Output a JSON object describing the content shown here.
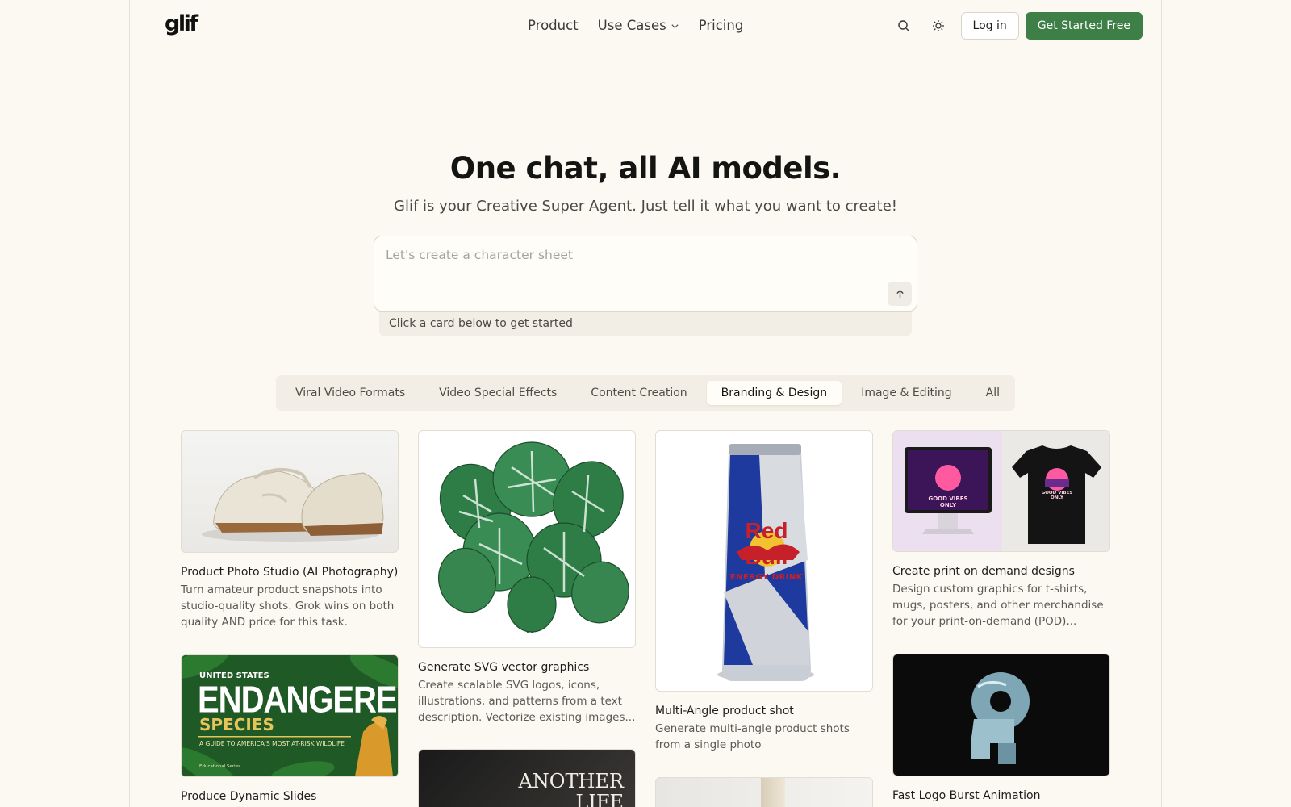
{
  "header": {
    "logo": "glif",
    "nav": [
      {
        "label": "Product"
      },
      {
        "label": "Use Cases"
      },
      {
        "label": "Pricing"
      }
    ],
    "login_label": "Log in",
    "cta_label": "Get Started Free",
    "cta_color": "#3e7e47"
  },
  "hero": {
    "title": "One chat, all AI models.",
    "subtitle": "Glif is your Creative Super Agent. Just tell it what you want to create!",
    "prompt_placeholder": "Let's create a character sheet",
    "hint": "Click a card below to get started"
  },
  "tabs": [
    {
      "label": "Viral Video Formats"
    },
    {
      "label": "Video Special Effects"
    },
    {
      "label": "Content Creation"
    },
    {
      "label": "Branding & Design",
      "active": true
    },
    {
      "label": "Image & Editing"
    },
    {
      "label": "All"
    }
  ],
  "cards": [
    {
      "title": "Product Photo Studio (AI Photography)",
      "desc": "Turn amateur product snapshots into studio-quality shots. Grok wins on both quality AND price for this task."
    },
    {
      "title": "Produce Dynamic Slides",
      "image_text": {
        "kicker": "UNITED STATES",
        "headline": "ENDANGERED",
        "subhead": "SPECIES",
        "caption": "A GUIDE TO AMERICA'S MOST AT-RISK WILDLIFE",
        "footer": "Educational Series"
      }
    },
    {
      "title": "Generate SVG vector graphics",
      "desc": "Create scalable SVG logos, icons, illustrations, and patterns from a text description. Vectorize existing images..."
    },
    {
      "title": "",
      "image_text": "ANOTHER LIFE"
    },
    {
      "title": "Multi-Angle product shot",
      "desc": "Generate multi-angle product shots from a single photo",
      "image_text": {
        "brand": "Red Bull",
        "sub": "ENERGY DRINK"
      }
    },
    {
      "title": "Create print on demand designs",
      "desc": "Design custom graphics for t-shirts, mugs, posters, and other merchandise for your print-on-demand (POD)...",
      "image_text": "GOOD VIBES ONLY"
    },
    {
      "title": "Fast Logo Burst Animation"
    }
  ]
}
